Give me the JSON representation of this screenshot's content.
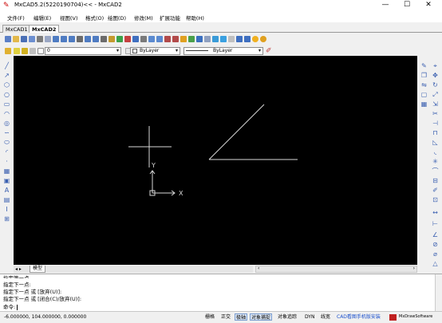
{
  "window": {
    "title": "MxCAD5.2(5220190704)<< - MxCAD2",
    "min": "—",
    "max": "☐",
    "close": "✕"
  },
  "menu": [
    "文件(F)",
    "编辑(E)",
    "视图(V)",
    "格式(O)",
    "绘图(D)",
    "修改(M)",
    "扩展功能",
    "帮助(H)"
  ],
  "tabs": [
    "MxCAD1",
    "MxCAD2"
  ],
  "toolbar2": {
    "layer_value": "0",
    "color_value": "ByLayer",
    "linetype_value": "ByLayer"
  },
  "canvas": {
    "axis_x": "X",
    "axis_y": "Y"
  },
  "layout_tabs": [
    "模型"
  ],
  "command": {
    "lines": [
      "指定第一点",
      "指定下一点:",
      "指定下一点 或 [放弃(U)]:",
      "指定下一点 或 [闭合(C)/放弃(U)]:"
    ],
    "prompt": "命令: "
  },
  "status": {
    "coords": "-6.000000, 104.000000, 0.000000",
    "buttons": [
      {
        "label": "栅格",
        "on": false
      },
      {
        "label": "正交",
        "on": false
      },
      {
        "label": "极轴",
        "on": true
      },
      {
        "label": "对象捕捉",
        "on": true
      },
      {
        "label": "对象追踪",
        "on": false
      },
      {
        "label": "DYN",
        "on": false
      },
      {
        "label": "线宽",
        "on": false
      }
    ],
    "promo": "CAD看图手机版安装",
    "brand": "MxDrawSoftware"
  },
  "colors": {
    "canvas_bg": "#000000",
    "promo_text": "#1a4fcc"
  }
}
